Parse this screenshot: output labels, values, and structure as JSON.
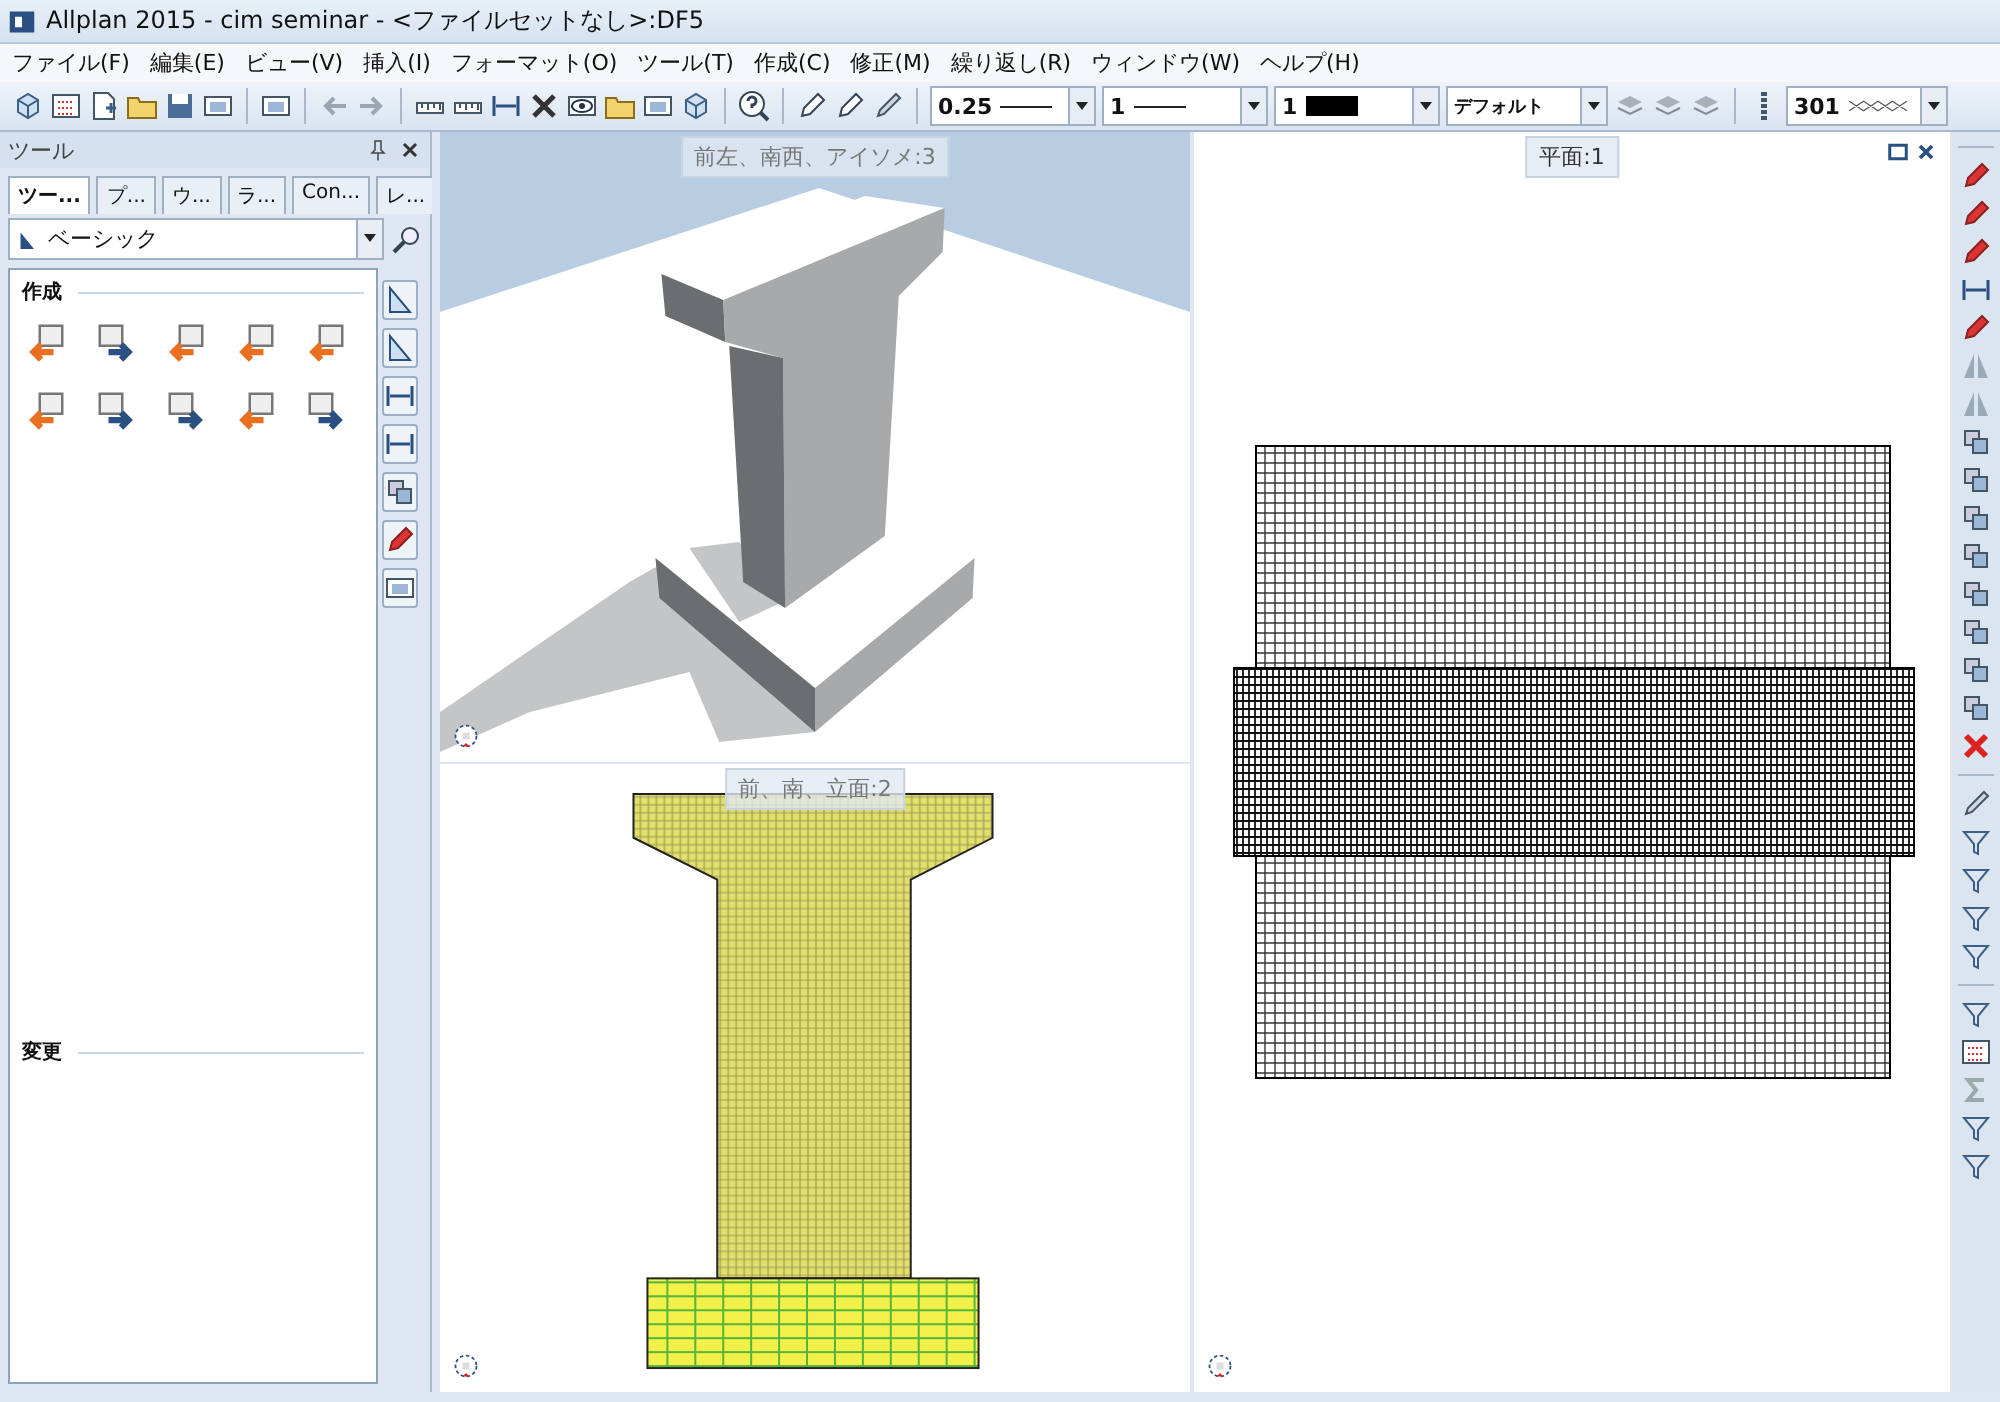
{
  "window": {
    "title": "Allplan 2015 - cim seminar - <ファイルセットなし>:DF5"
  },
  "menu": [
    "ファイル(F)",
    "編集(E)",
    "ビュー(V)",
    "挿入(I)",
    "フォーマット(O)",
    "ツール(T)",
    "作成(C)",
    "修正(M)",
    "繰り返し(R)",
    "ウィンドウ(W)",
    "ヘルプ(H)"
  ],
  "toolbar": {
    "pen_thickness": "0.25",
    "line_type": "1",
    "color_number": "1",
    "format": "デフォルト",
    "hatch": "301"
  },
  "tools_panel": {
    "title": "ツール",
    "tabs": [
      {
        "label": "ツー...",
        "selected": true
      },
      {
        "label": "プ...",
        "selected": false
      },
      {
        "label": "ウ...",
        "selected": false
      },
      {
        "label": "ラ...",
        "selected": false
      },
      {
        "label": "Con...",
        "selected": false
      },
      {
        "label": "レ...",
        "selected": false
      }
    ],
    "module": "ベーシック",
    "sections": [
      {
        "title": "作成"
      },
      {
        "title": "変更"
      }
    ]
  },
  "viewports": [
    {
      "label": "前左、南西、アイソメ:3",
      "kind": "iso"
    },
    {
      "label": "前、南、立面:2",
      "kind": "elevation"
    },
    {
      "label": "平面:1",
      "kind": "plan"
    }
  ]
}
